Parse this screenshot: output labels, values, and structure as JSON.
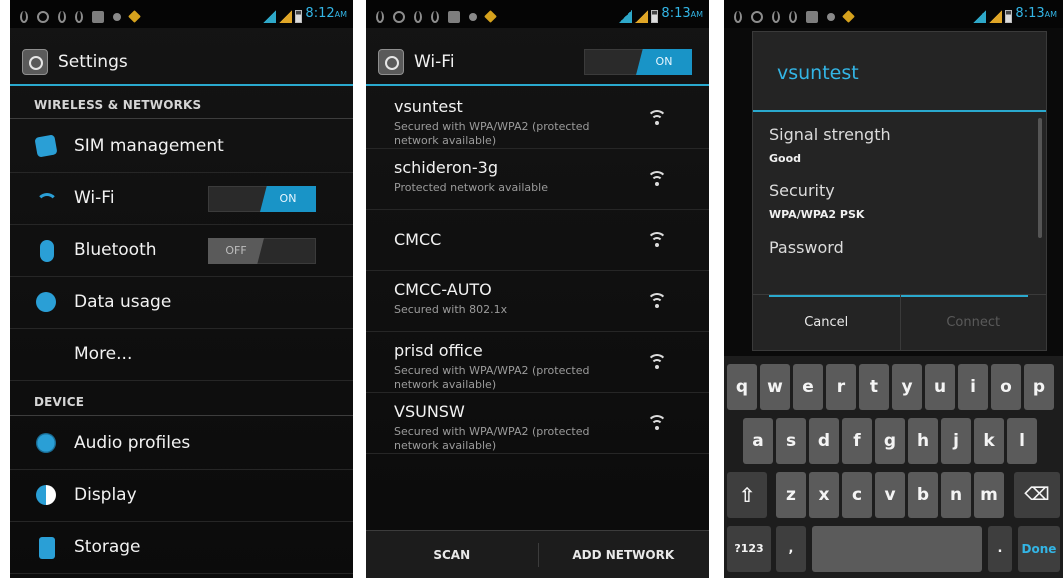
{
  "status": {
    "time1": "8:12",
    "time2": "8:13",
    "time3": "8:13",
    "ampm": "AM"
  },
  "settings": {
    "title": "Settings",
    "section_wireless": "WIRELESS & NETWORKS",
    "section_device": "DEVICE",
    "items": [
      {
        "label": "SIM management"
      },
      {
        "label": "Wi-Fi",
        "toggle": "ON"
      },
      {
        "label": "Bluetooth",
        "toggle": "OFF"
      },
      {
        "label": "Data usage"
      },
      {
        "label": "More..."
      }
    ],
    "device_items": [
      {
        "label": "Audio profiles"
      },
      {
        "label": "Display"
      },
      {
        "label": "Storage"
      }
    ]
  },
  "wifi": {
    "title": "Wi-Fi",
    "toggle": "ON",
    "networks": [
      {
        "name": "vsuntest",
        "sub": "Secured with WPA/WPA2 (protected network available)"
      },
      {
        "name": "schideron-3g",
        "sub": "Protected network available"
      },
      {
        "name": "CMCC",
        "sub": ""
      },
      {
        "name": "CMCC-AUTO",
        "sub": "Secured with 802.1x"
      },
      {
        "name": "prisd office",
        "sub": "Secured with WPA/WPA2 (protected network available)"
      },
      {
        "name": "VSUNSW",
        "sub": "Secured with WPA/WPA2 (protected network available)"
      }
    ],
    "scan_label": "SCAN",
    "add_label": "ADD NETWORK"
  },
  "dialog": {
    "title": "vsuntest",
    "signal_label": "Signal strength",
    "signal_value": "Good",
    "security_label": "Security",
    "security_value": "WPA/WPA2 PSK",
    "password_label": "Password",
    "password_value": "",
    "cancel_label": "Cancel",
    "connect_label": "Connect"
  },
  "keyboard": {
    "row1": [
      "q",
      "w",
      "e",
      "r",
      "t",
      "y",
      "u",
      "i",
      "o",
      "p"
    ],
    "row2": [
      "a",
      "s",
      "d",
      "f",
      "g",
      "h",
      "j",
      "k",
      "l"
    ],
    "row3": [
      "z",
      "x",
      "c",
      "v",
      "b",
      "n",
      "m"
    ],
    "shift": "⇧",
    "backspace": "⌫",
    "symbols": "?123",
    "comma": ",",
    "period": ".",
    "done": "Done"
  }
}
